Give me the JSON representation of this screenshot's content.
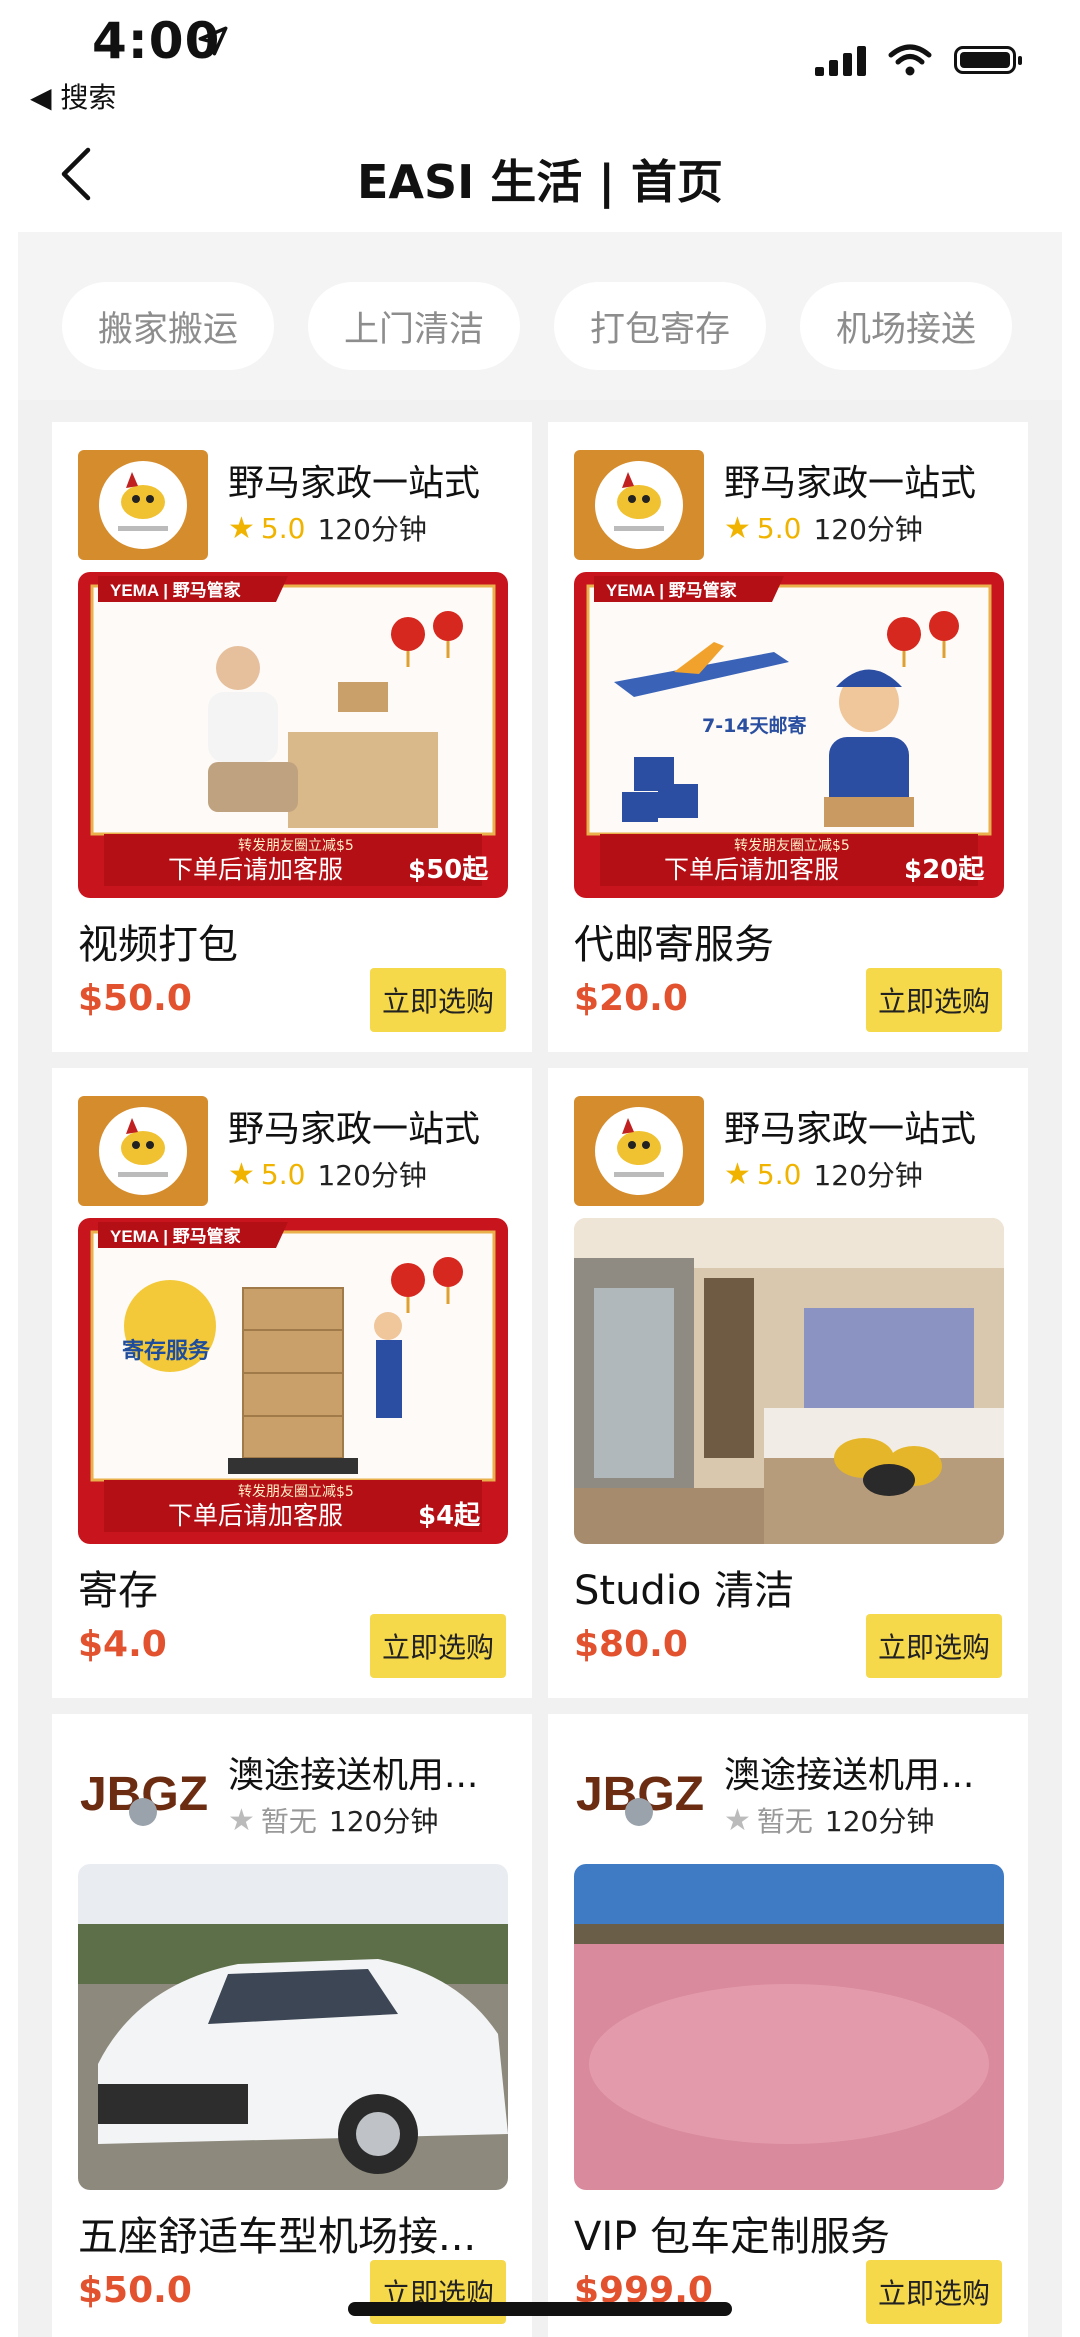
{
  "status_bar": {
    "time": "4:00",
    "back_to_app": "◀ 搜索"
  },
  "header": {
    "title": "EASI 生活 | 首页"
  },
  "tabs": [
    {
      "label": "搬家搬运"
    },
    {
      "label": "上门清洁"
    },
    {
      "label": "打包寄存"
    },
    {
      "label": "机场接送"
    }
  ],
  "cards": [
    {
      "shop": "野马家政一站式",
      "rating": "5.0",
      "duration": "120分钟",
      "banner_text": "下单后请加客服",
      "banner_sub": "转发朋友圈立减$5",
      "banner_price": "$50起",
      "title": "视频打包",
      "price": "$50.0",
      "button": "立即选购"
    },
    {
      "shop": "野马家政一站式",
      "rating": "5.0",
      "duration": "120分钟",
      "banner_text": "下单后请加客服",
      "banner_sub": "转发朋友圈立减$5",
      "banner_price": "$20起",
      "banner_badge": "7-14天邮寄",
      "title": "代邮寄服务",
      "price": "$20.0",
      "button": "立即选购"
    },
    {
      "shop": "野马家政一站式",
      "rating": "5.0",
      "duration": "120分钟",
      "banner_text": "下单后请加客服",
      "banner_sub": "转发朋友圈立减$5",
      "banner_price": "$4起",
      "banner_badge": "寄存服务",
      "title": "寄存",
      "price": "$4.0",
      "button": "立即选购"
    },
    {
      "shop": "野马家政一站式",
      "rating": "5.0",
      "duration": "120分钟",
      "title": "Studio 清洁",
      "price": "$80.0",
      "button": "立即选购"
    },
    {
      "shop": "澳途接送机用...",
      "rating": "暂无",
      "duration": "120分钟",
      "title": "五座舒适车型机场接...",
      "price": "$50.0",
      "button": "立即选购"
    },
    {
      "shop": "澳途接送机用...",
      "rating": "暂无",
      "duration": "120分钟",
      "title": "VIP 包车定制服务",
      "price": "$999.0",
      "button": "立即选购"
    }
  ],
  "brand": {
    "yema_logo": "YEMA | 野马管家",
    "jbgz_logo": "JBGZ"
  },
  "colors": {
    "price": "#e2522e",
    "button": "#f6d94a",
    "star": "#f0b400",
    "banner_red": "#c8141c"
  }
}
